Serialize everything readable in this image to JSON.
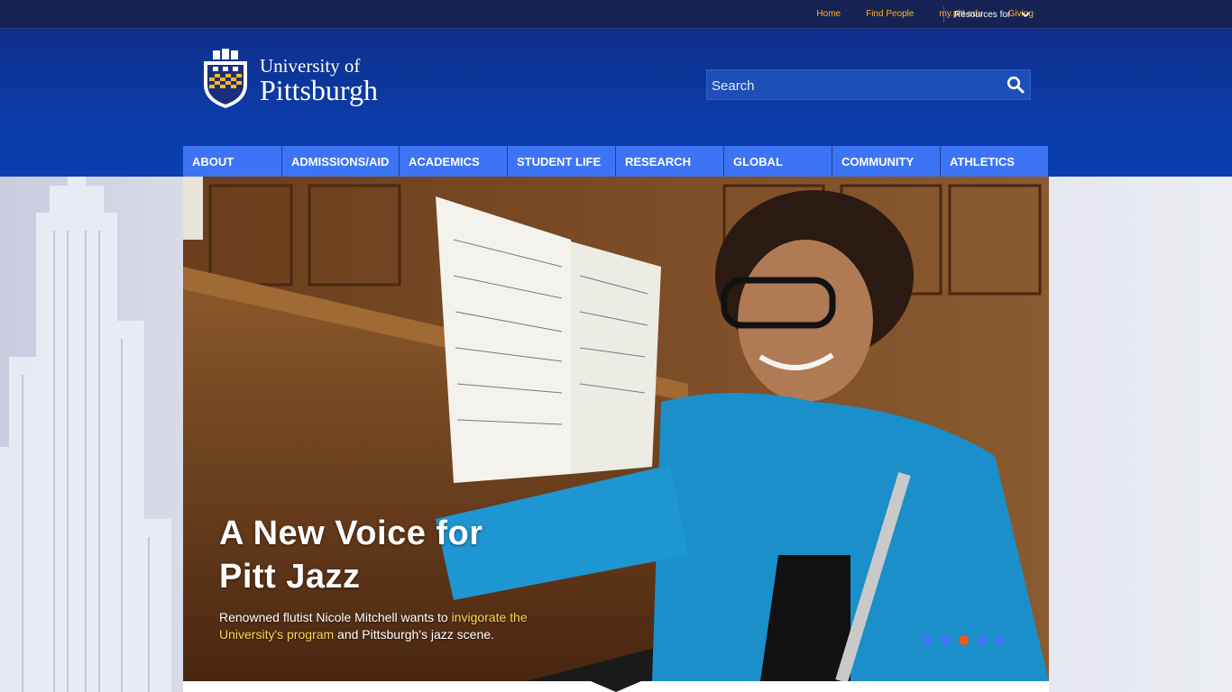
{
  "utility": {
    "links": [
      "Home",
      "Find People",
      "my.pitt.edu",
      "Giving"
    ],
    "resources_label": "Resources for"
  },
  "logo": {
    "line1": "University of",
    "line2": "Pittsburgh"
  },
  "search": {
    "placeholder": "Search"
  },
  "nav": {
    "items": [
      "ABOUT",
      "ADMISSIONS/AID",
      "ACADEMICS",
      "STUDENT LIFE",
      "RESEARCH",
      "GLOBAL",
      "COMMUNITY",
      "ATHLETICS"
    ]
  },
  "hero": {
    "title_line1": "A New Voice for",
    "title_line2": "Pitt Jazz",
    "desc_before": "Renowned flutist Nicole Mitchell wants to ",
    "desc_link": "invigorate the University's program",
    "desc_after": " and Pittsburgh's jazz scene.",
    "slides_total": 5,
    "active_slide": 3
  },
  "colors": {
    "utility_bg": "#162154",
    "header_bg": "#0c3aa6",
    "nav_bg": "#3d74f5",
    "gold": "#ffb81c",
    "highlight": "#ffd84a",
    "dot_active": "#f05a1a",
    "dot_inactive": "#3d74f5"
  }
}
